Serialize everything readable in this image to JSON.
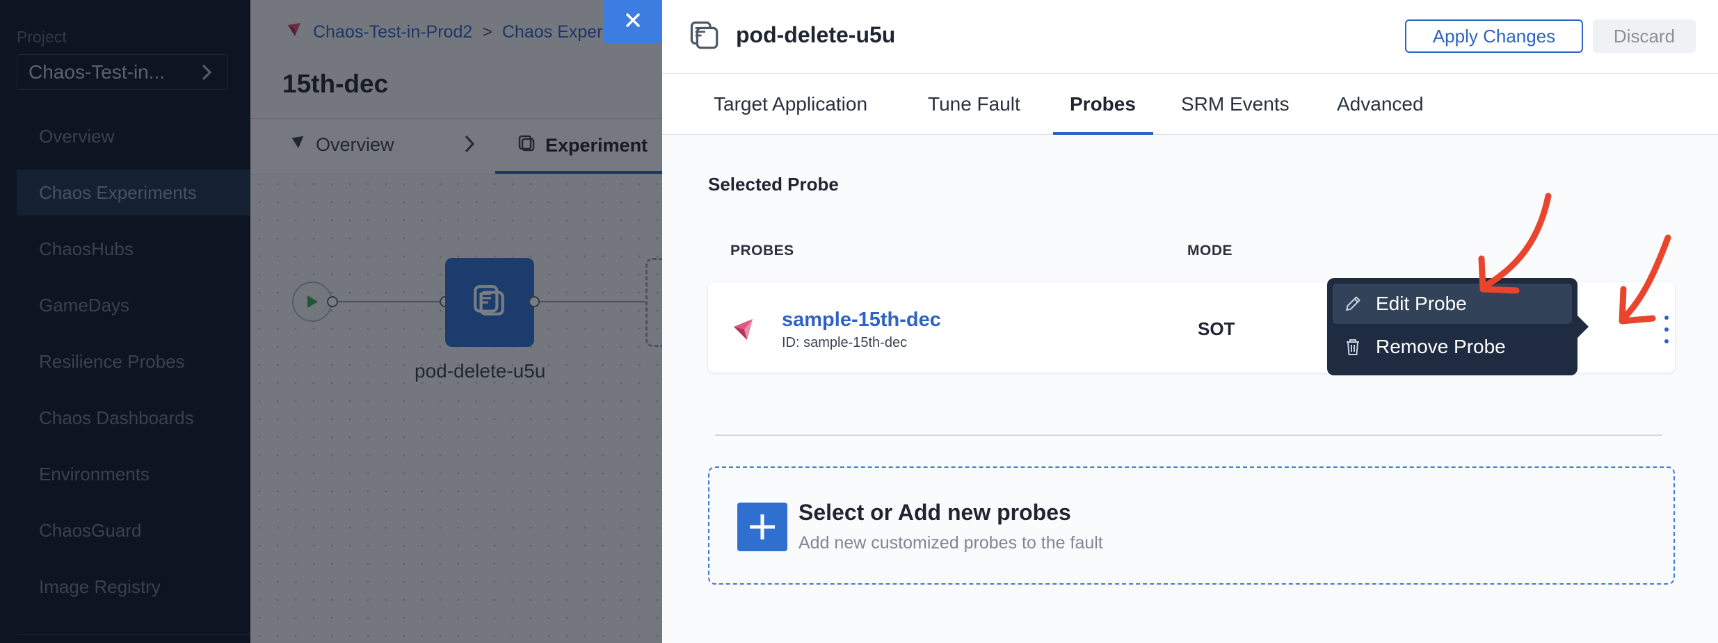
{
  "sidebar": {
    "project_label": "Project",
    "project_name": "Chaos-Test-in...",
    "items": [
      {
        "label": "Overview"
      },
      {
        "label": "Chaos Experiments"
      },
      {
        "label": "ChaosHubs"
      },
      {
        "label": "GameDays"
      },
      {
        "label": "Resilience Probes"
      },
      {
        "label": "Chaos Dashboards"
      },
      {
        "label": "Environments"
      },
      {
        "label": "ChaosGuard"
      },
      {
        "label": "Image Registry"
      }
    ]
  },
  "background": {
    "breadcrumb": [
      "Chaos-Test-in-Prod2",
      ">",
      "Chaos Experi"
    ],
    "title": "15th-dec",
    "tabs": [
      {
        "label": "Overview"
      },
      {
        "label": "Experiment"
      }
    ],
    "fault_node_label": "pod-delete-u5u"
  },
  "drawer": {
    "title": "pod-delete-u5u",
    "apply_label": "Apply Changes",
    "discard_label": "Discard",
    "tabs": [
      {
        "label": "Target Application"
      },
      {
        "label": "Tune Fault"
      },
      {
        "label": "Probes"
      },
      {
        "label": "SRM Events"
      },
      {
        "label": "Advanced"
      }
    ],
    "active_tab": "Probes",
    "section_title": "Selected Probe",
    "columns": {
      "probes": "PROBES",
      "mode": "MODE"
    },
    "probe": {
      "name": "sample-15th-dec",
      "id": "ID: sample-15th-dec",
      "mode": "SOT"
    },
    "menu": [
      {
        "label": "Edit Probe",
        "icon": "pencil-icon"
      },
      {
        "label": "Remove Probe",
        "icon": "trash-icon"
      }
    ],
    "add": {
      "title": "Select or Add new probes",
      "subtitle": "Add new customized probes to the fault"
    }
  },
  "colors": {
    "accent": "#2f63c0",
    "sidebar_bg": "#0f1a2b",
    "menu_bg": "#1e2b40",
    "annotation_arrow": "#e8452c"
  }
}
